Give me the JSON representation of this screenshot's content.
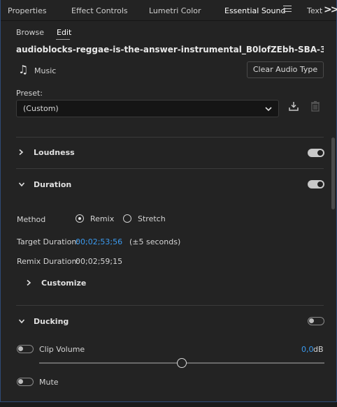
{
  "tabs": [
    "Properties",
    "Effect Controls",
    "Lumetri Color",
    "Essential Sound",
    "Text"
  ],
  "active_tab": "Essential Sound",
  "subtabs": {
    "browse": "Browse",
    "edit": "Edit"
  },
  "clip_name": "audioblocks-reggae-is-the-answer-instrumental_B0lofZEbh-SBA-347519...",
  "audio_type": {
    "label": "Music",
    "clear_button": "Clear Audio Type"
  },
  "preset": {
    "label": "Preset:",
    "value": "(Custom)"
  },
  "sections": {
    "loudness": {
      "title": "Loudness",
      "enabled": true
    },
    "duration": {
      "title": "Duration",
      "enabled": true,
      "method_label": "Method",
      "method_options": [
        "Remix",
        "Stretch"
      ],
      "method_selected": "Remix",
      "target_label": "Target Duration:",
      "target_value": "00;02;53;56",
      "target_tolerance": "(±5 seconds)",
      "remix_label": "Remix Duration:",
      "remix_value": "00;02;59;15",
      "customize": "Customize"
    },
    "ducking": {
      "title": "Ducking",
      "enabled": false,
      "clip_volume_label": "Clip Volume",
      "clip_volume_value": "0,0",
      "clip_volume_unit": "dB",
      "mute_label": "Mute"
    }
  },
  "colors": {
    "accent": "#3b9bf0",
    "panel": "#232323",
    "border": "#2f4a76"
  },
  "icons": [
    "panel-menu-icon",
    "overflow-icon",
    "music-note-icon",
    "chevron-down-icon",
    "save-preset-icon",
    "trash-icon",
    "chevron-right-icon"
  ]
}
